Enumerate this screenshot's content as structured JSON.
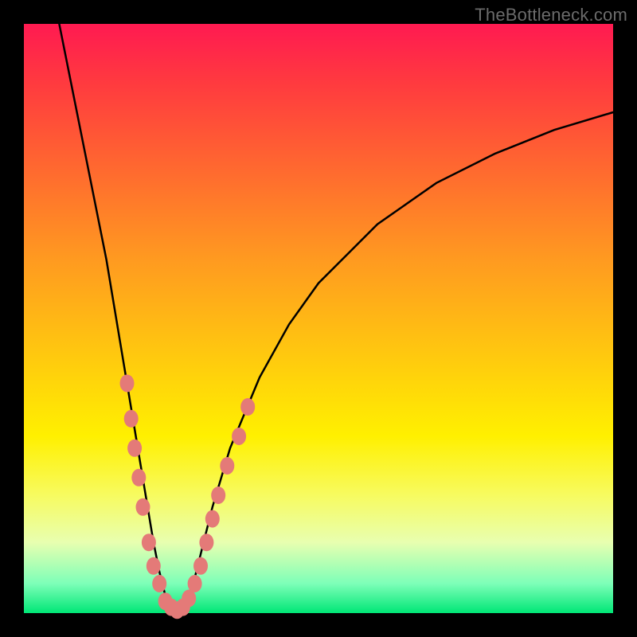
{
  "watermark": "TheBottleneck.com",
  "colors": {
    "frame": "#000000",
    "curve": "#000000",
    "markers": "#e47a78",
    "gradient_top": "#ff1a51",
    "gradient_bottom": "#00e676"
  },
  "chart_data": {
    "type": "line",
    "title": "",
    "xlabel": "",
    "ylabel": "",
    "xlim": [
      0,
      100
    ],
    "ylim": [
      0,
      100
    ],
    "series": [
      {
        "name": "bottleneck-curve",
        "x": [
          6,
          8,
          10,
          12,
          14,
          16,
          17,
          18,
          19,
          20,
          21,
          22,
          23,
          24,
          25,
          26,
          27,
          28,
          29,
          30,
          32,
          35,
          40,
          45,
          50,
          55,
          60,
          70,
          80,
          90,
          100
        ],
        "values": [
          100,
          90,
          80,
          70,
          60,
          48,
          42,
          36,
          30,
          24,
          18,
          12,
          7,
          3,
          1,
          0,
          1,
          3,
          6,
          10,
          18,
          28,
          40,
          49,
          56,
          61,
          66,
          73,
          78,
          82,
          85
        ]
      }
    ],
    "markers": {
      "name": "sample-points",
      "points": [
        {
          "x": 17.5,
          "y": 39
        },
        {
          "x": 18.2,
          "y": 33
        },
        {
          "x": 18.8,
          "y": 28
        },
        {
          "x": 19.5,
          "y": 23
        },
        {
          "x": 20.2,
          "y": 18
        },
        {
          "x": 21.2,
          "y": 12
        },
        {
          "x": 22.0,
          "y": 8
        },
        {
          "x": 23.0,
          "y": 5
        },
        {
          "x": 24.0,
          "y": 2
        },
        {
          "x": 25.0,
          "y": 1
        },
        {
          "x": 26.0,
          "y": 0.5
        },
        {
          "x": 27.0,
          "y": 1
        },
        {
          "x": 28.0,
          "y": 2.5
        },
        {
          "x": 29.0,
          "y": 5
        },
        {
          "x": 30.0,
          "y": 8
        },
        {
          "x": 31.0,
          "y": 12
        },
        {
          "x": 32.0,
          "y": 16
        },
        {
          "x": 33.0,
          "y": 20
        },
        {
          "x": 34.5,
          "y": 25
        },
        {
          "x": 36.5,
          "y": 30
        },
        {
          "x": 38.0,
          "y": 35
        }
      ]
    }
  }
}
